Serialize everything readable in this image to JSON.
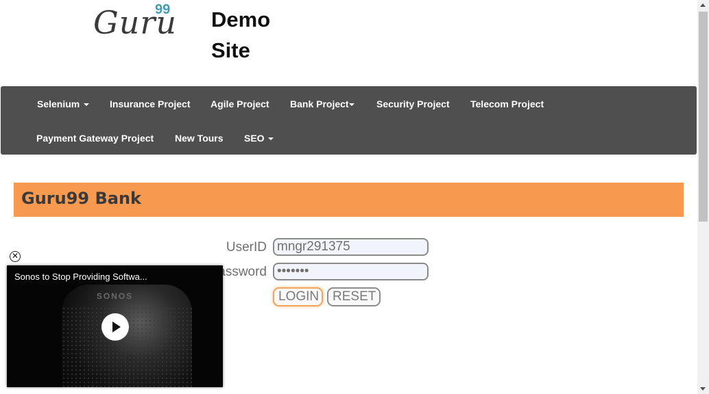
{
  "logo": {
    "text": "Guru",
    "superscript": "99"
  },
  "site_title": {
    "line1": "Demo",
    "line2": "Site"
  },
  "nav": {
    "items": [
      {
        "label": "Selenium",
        "has_dropdown": true
      },
      {
        "label": "Insurance Project",
        "has_dropdown": false
      },
      {
        "label": "Agile Project",
        "has_dropdown": false
      },
      {
        "label": "Bank Project",
        "has_dropdown": true
      },
      {
        "label": "Security Project",
        "has_dropdown": false
      },
      {
        "label": "Telecom Project",
        "has_dropdown": false
      },
      {
        "label": "Payment Gateway Project",
        "has_dropdown": false
      },
      {
        "label": "New Tours",
        "has_dropdown": false
      },
      {
        "label": "SEO",
        "has_dropdown": true
      }
    ]
  },
  "bank": {
    "title": "Guru99 Bank"
  },
  "login_form": {
    "userid_label": "UserID",
    "userid_value": "mngr291375",
    "password_label": "assword",
    "password_value": "•••••••",
    "login_button": "LOGIN",
    "reset_button": "RESET"
  },
  "video": {
    "title": "Sonos to Stop Providing Softwa...",
    "brand": "SONOS",
    "close_icon": "close-circle-icon",
    "play_icon": "play-icon"
  },
  "colors": {
    "navbar_bg": "#4f4f4f",
    "bank_header_bg": "#f7994e",
    "logo_accent": "#3f9fb0"
  }
}
